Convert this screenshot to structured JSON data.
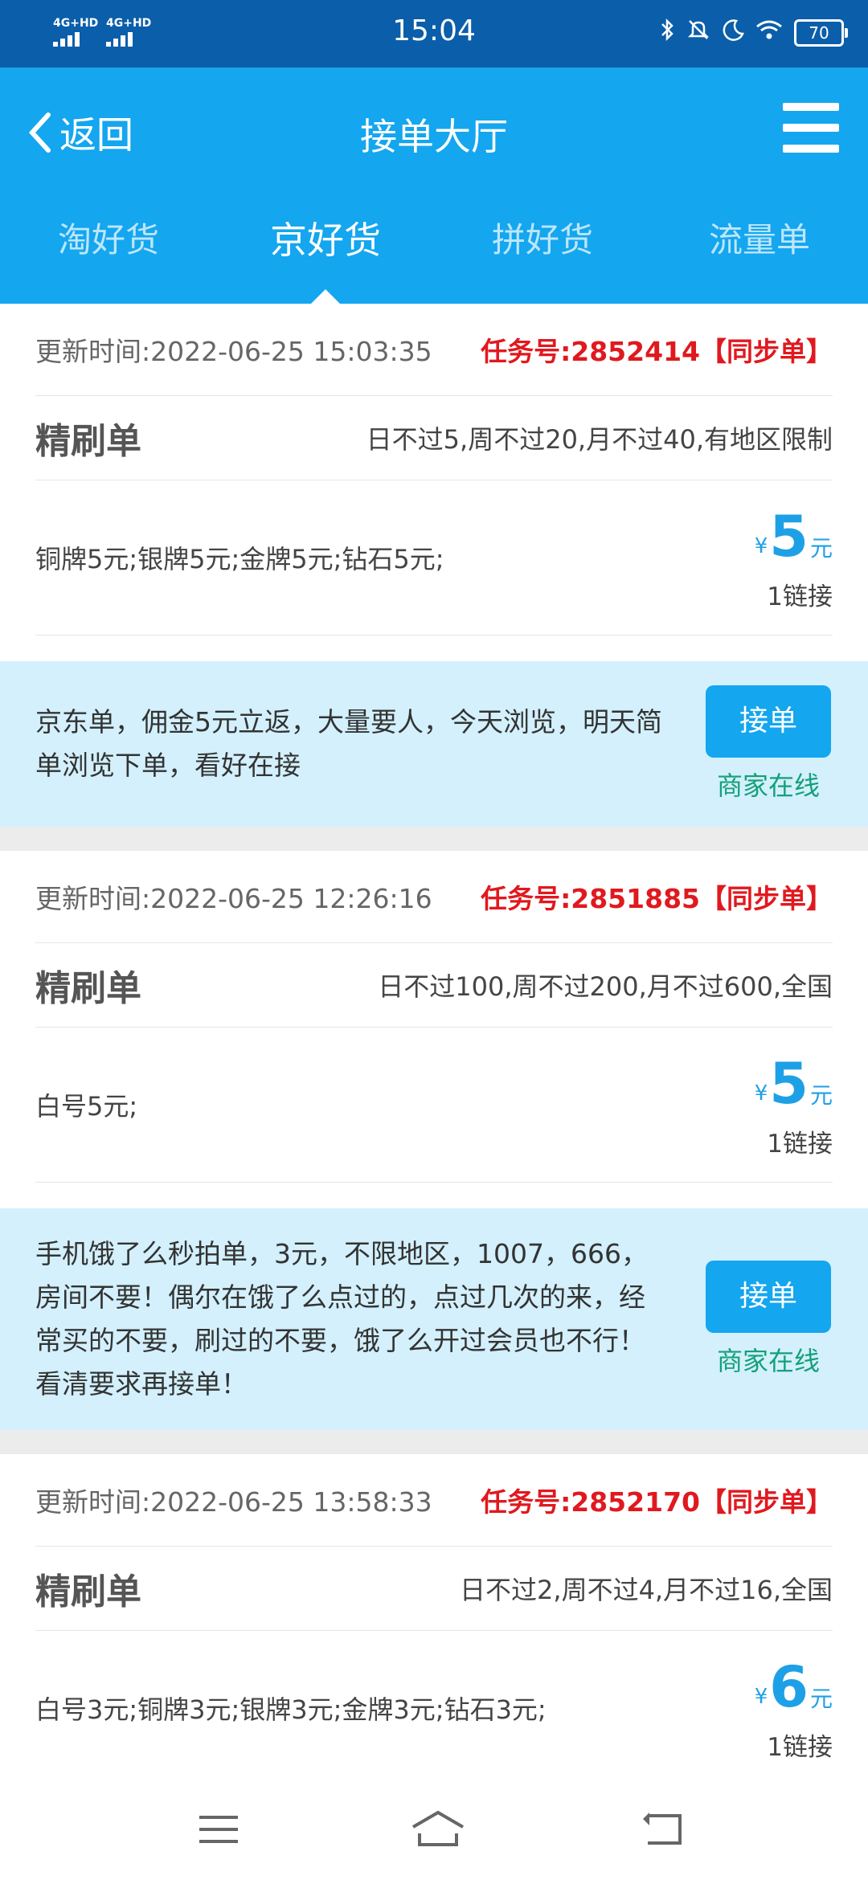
{
  "status_bar": {
    "signal_1": "4G+HD",
    "signal_2": "4G+HD",
    "time": "15:04",
    "icons": [
      "bluetooth-icon",
      "mute-icon",
      "moon-icon",
      "wifi-icon"
    ],
    "battery": "70"
  },
  "header": {
    "back_label": "返回",
    "title": "接单大厅",
    "tabs": [
      {
        "label": "淘好货",
        "active": false
      },
      {
        "label": "京好货",
        "active": true
      },
      {
        "label": "拼好货",
        "active": false
      },
      {
        "label": "流量单",
        "active": false
      }
    ]
  },
  "orders": [
    {
      "time": "更新时间:2022-06-25 15:03:35",
      "task_no": "任务号:2852414【同步单】",
      "type": "精刷单",
      "limits": "日不过5,周不过20,月不过40,有地区限制",
      "tiers": "铜牌5元;银牌5元;金牌5元;钻石5元;",
      "currency": "¥",
      "amount": "5",
      "unit": "元",
      "links": "1链接",
      "notice": "京东单，佣金5元立返，大量要人，今天浏览，明天简单浏览下单，看好在接",
      "button": "接单",
      "status": "商家在线"
    },
    {
      "time": "更新时间:2022-06-25 12:26:16",
      "task_no": "任务号:2851885【同步单】",
      "type": "精刷单",
      "limits": "日不过100,周不过200,月不过600,全国",
      "tiers": "白号5元;",
      "currency": "¥",
      "amount": "5",
      "unit": "元",
      "links": "1链接",
      "notice": "手机饿了么秒拍单，3元，不限地区，1007，666，房间不要！偶尔在饿了么点过的，点过几次的来，经常买的不要，刷过的不要，饿了么开过会员也不行！看清要求再接单！",
      "button": "接单",
      "status": "商家在线"
    },
    {
      "time": "更新时间:2022-06-25 13:58:33",
      "task_no": "任务号:2852170【同步单】",
      "type": "精刷单",
      "limits": "日不过2,周不过4,月不过16,全国",
      "tiers": "白号3元;铜牌3元;银牌3元;金牌3元;钻石3元;",
      "currency": "¥",
      "amount": "6",
      "unit": "元",
      "links": "1链接"
    }
  ],
  "nav_bar": {
    "buttons": [
      "menu-icon",
      "home-icon",
      "back-icon"
    ]
  },
  "colors": {
    "header_bg": "#14a6ef",
    "status_bar_bg": "#0b5ea9",
    "task_no": "#e0191f",
    "price": "#1ea0e6",
    "notice_bg": "#d3f0fc",
    "online": "#14a07a"
  }
}
